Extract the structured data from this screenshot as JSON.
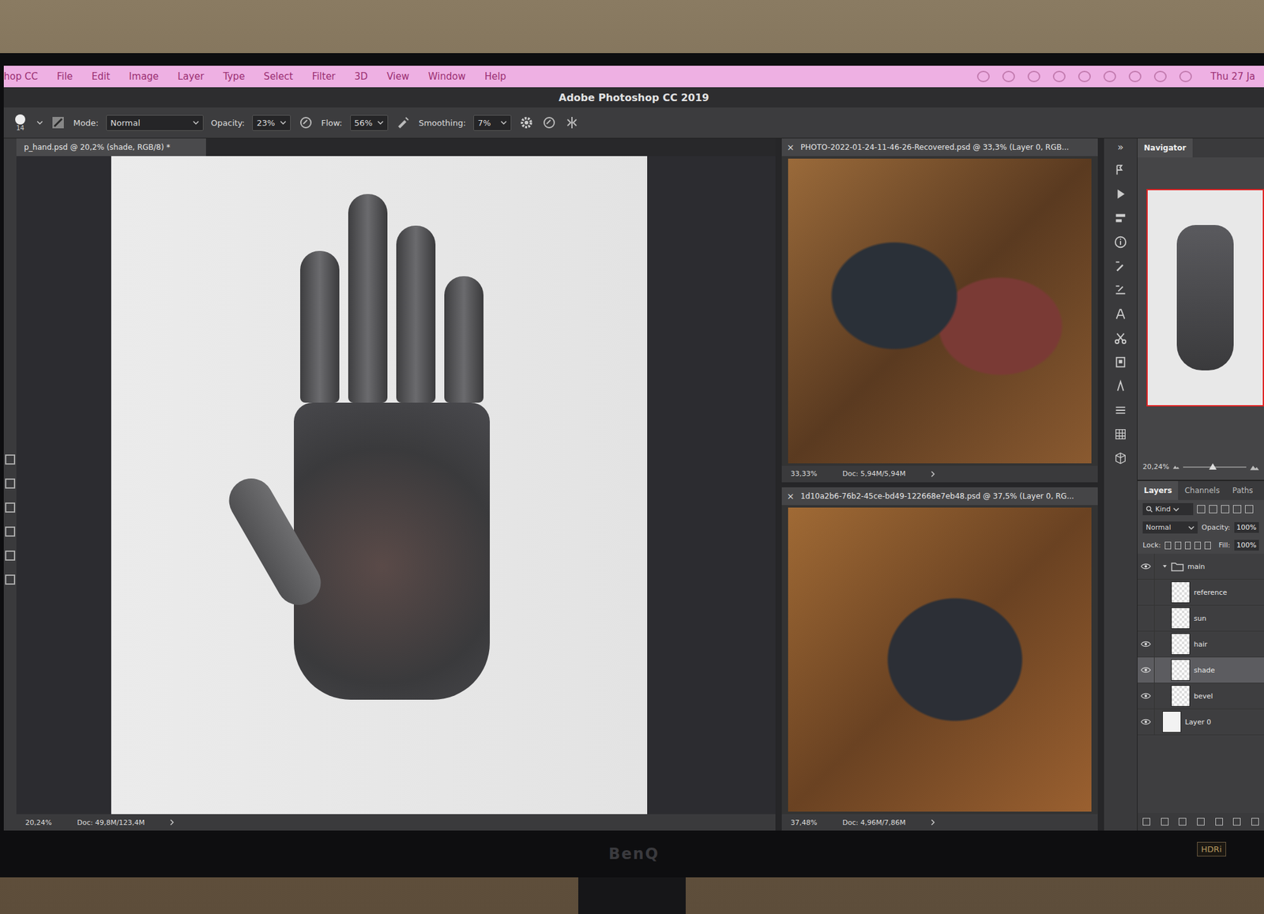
{
  "menubar": {
    "app": "hop CC",
    "items": [
      "File",
      "Edit",
      "Image",
      "Layer",
      "Type",
      "Select",
      "Filter",
      "3D",
      "View",
      "Window",
      "Help"
    ],
    "clock": "Thu 27 Ja"
  },
  "window": {
    "title": "Adobe Photoshop CC 2019"
  },
  "options": {
    "brush_size": "14",
    "mode_label": "Mode:",
    "mode": "Normal",
    "opacity_label": "Opacity:",
    "opacity": "23%",
    "flow_label": "Flow:",
    "flow": "56%",
    "smoothing_label": "Smoothing:",
    "smoothing": "7%"
  },
  "documents": [
    {
      "tab": "p_hand.psd @ 20,2% (shade, RGB/8) *",
      "zoom": "20,24%",
      "doc": "Doc: 49,8M/123,4M",
      "active": true,
      "close": ""
    },
    {
      "tab": "PHOTO-2022-01-24-11-46-26-Recovered.psd @ 33,3% (Layer 0, RGB...",
      "zoom": "33,33%",
      "doc": "Doc: 5,94M/5,94M",
      "active": false,
      "close": "×"
    },
    {
      "tab": "1d10a2b6-76b2-45ce-bd49-122668e7eb48.psd @ 37,5% (Layer 0, RG...",
      "zoom": "37,48%",
      "doc": "Doc: 4,96M/7,86M",
      "active": false,
      "close": "×"
    }
  ],
  "panel_toggle": "»",
  "navigator": {
    "title": "Navigator",
    "zoom": "20,24%",
    "level": 0.47
  },
  "layers_panel": {
    "tabs": [
      {
        "label": "Layers",
        "selected": true
      },
      {
        "label": "Channels",
        "selected": false
      },
      {
        "label": "Paths",
        "selected": false
      }
    ],
    "filter": "Kind",
    "blend": "Normal",
    "opacity_label": "Opacity:",
    "opacity": "100%",
    "lock_label": "Lock:",
    "fill_label": "Fill:",
    "fill": "100%",
    "layers": [
      {
        "name": "main",
        "kind": "group",
        "visible": true,
        "expanded": true,
        "selected": false,
        "children": [
          {
            "name": "reference",
            "kind": "layer",
            "visible": false,
            "selected": false
          },
          {
            "name": "sun",
            "kind": "layer",
            "visible": false,
            "selected": false
          },
          {
            "name": "hair",
            "kind": "layer",
            "visible": true,
            "selected": false
          },
          {
            "name": "shade",
            "kind": "layer",
            "visible": true,
            "selected": true
          },
          {
            "name": "bevel",
            "kind": "layer",
            "visible": true,
            "selected": false
          }
        ]
      },
      {
        "name": "Layer 0",
        "kind": "background",
        "visible": true,
        "selected": false
      }
    ]
  },
  "monitor": {
    "brand": "BenQ",
    "badge": "HDRi"
  }
}
